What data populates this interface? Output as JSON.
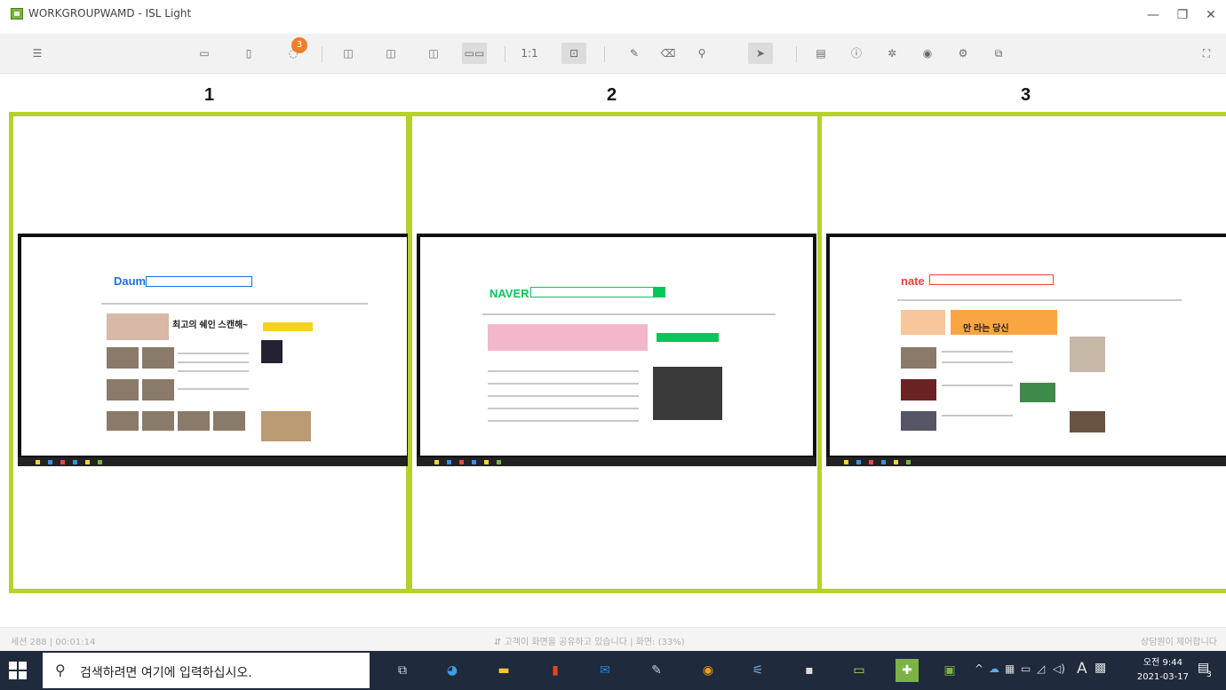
{
  "window": {
    "title": "WORKGROUPWAMD - ISL Light",
    "controls": [
      "—",
      "❐",
      "✕"
    ]
  },
  "toolbar": {
    "menu_glyph": "☰",
    "notification_count": "3",
    "one_to_one": "1:1",
    "fullscreen_glyph": "⛶"
  },
  "monitors": [
    {
      "label": "1",
      "site_logo": "Daum",
      "banner_text": "최고의 쉐인 스캔해~",
      "accent": "#1f6ee5"
    },
    {
      "label": "2",
      "site_logo": "NAVER",
      "banner_text": "",
      "accent": "#03c75a"
    },
    {
      "label": "3",
      "site_logo": "nate",
      "banner_text": "만 라는 당신",
      "accent": "#ff3c3c"
    }
  ],
  "status": {
    "left": "세션 288 | 00:01:14",
    "center": "고객이 화면을 공유하고 있습니다 | 화면: (33%)",
    "right": "상담원이 제어합니다"
  },
  "taskbar": {
    "search_placeholder": "검색하려면 여기에 입력하십시오.",
    "time": "오전 9:44",
    "date": "2021-03-17",
    "ime": "A",
    "notification_count": "3"
  },
  "colors": {
    "monitor_border": "#b5d22c",
    "taskbar_bg": "#1f2a3c"
  }
}
